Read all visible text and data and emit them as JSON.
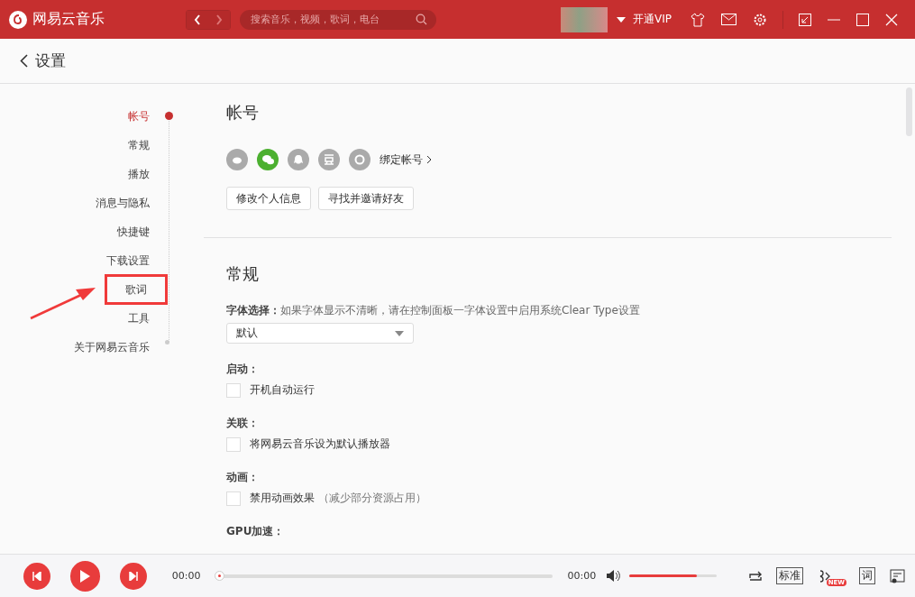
{
  "titlebar": {
    "app_name": "网易云音乐",
    "search": {
      "placeholder": "搜索音乐，视频，歌词，电台"
    },
    "vip": "开通VIP"
  },
  "page_title": "设置",
  "nav": [
    {
      "label": "帐号",
      "selected": true,
      "annotated": false
    },
    {
      "label": "常规",
      "selected": false,
      "annotated": false
    },
    {
      "label": "播放",
      "selected": false,
      "annotated": false
    },
    {
      "label": "消息与隐私",
      "selected": false,
      "annotated": false
    },
    {
      "label": "快捷键",
      "selected": false,
      "annotated": false
    },
    {
      "label": "下载设置",
      "selected": false,
      "annotated": false
    },
    {
      "label": "歌词",
      "selected": false,
      "annotated": true
    },
    {
      "label": "工具",
      "selected": false,
      "annotated": false
    },
    {
      "label": "关于网易云音乐",
      "selected": false,
      "annotated": false
    }
  ],
  "account": {
    "title": "帐号",
    "accounts": [
      {
        "kind": "weibo",
        "bound": false
      },
      {
        "kind": "wechat",
        "bound": true
      },
      {
        "kind": "qq",
        "bound": false
      },
      {
        "kind": "douban",
        "bound": false
      },
      {
        "kind": "yixin",
        "bound": false
      }
    ],
    "bind_link": "绑定帐号",
    "buttons": [
      "修改个人信息",
      "寻找并邀请好友"
    ]
  },
  "general": {
    "title": "常规",
    "font": {
      "label": "字体选择：",
      "hint": "如果字体显示不清晰，请在控制面板一字体设置中启用系统Clear Type设置",
      "value": "默认"
    },
    "options": [
      {
        "label": "启动：",
        "text": "开机自动运行",
        "checked": false
      },
      {
        "label": "关联：",
        "text": "将网易云音乐设为默认播放器",
        "checked": false
      },
      {
        "label": "动画：",
        "text": "禁用动画效果",
        "note": "（减少部分资源占用）",
        "checked": false
      }
    ],
    "next_label": "GPU加速："
  },
  "player": {
    "elapsed": "00:00",
    "progress": {
      "level": 0
    },
    "duration": "00:00",
    "volume": {
      "level": 0.78
    },
    "quality": "标准",
    "new_badge": "NEW",
    "lyrics": "词"
  }
}
